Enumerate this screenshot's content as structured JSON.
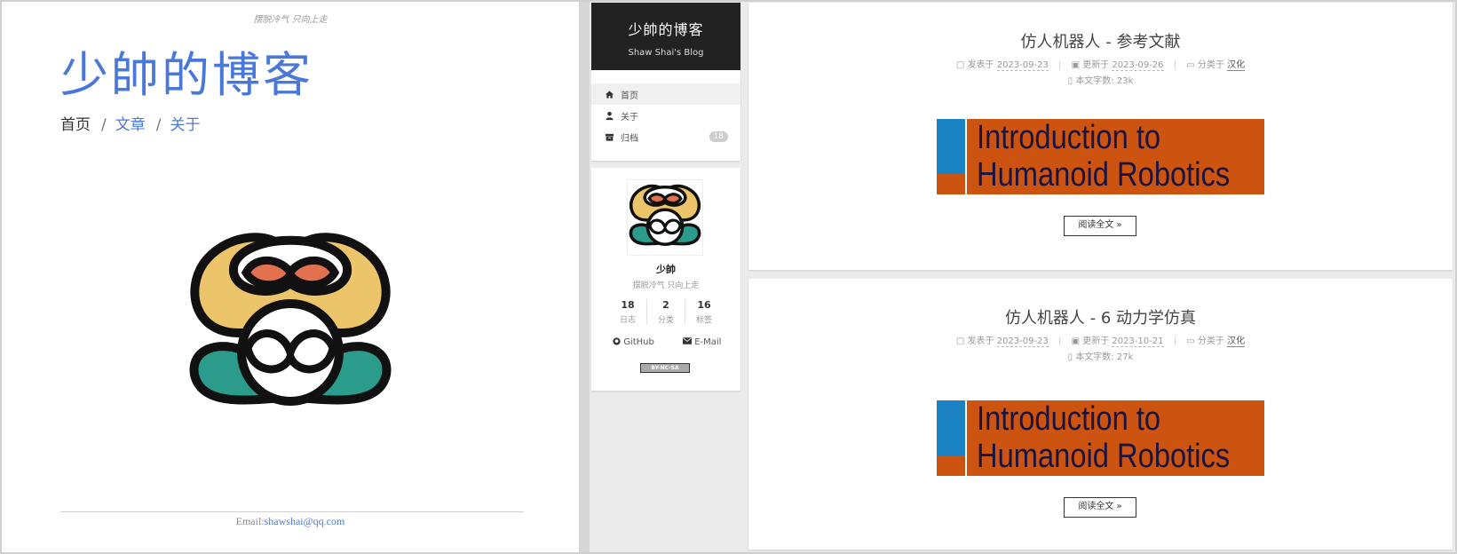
{
  "left_page": {
    "motto": "摆脱冷气 只向上走",
    "title": "少帥的博客",
    "nav": {
      "home": "首页",
      "sep1": "/",
      "articles": "文章",
      "sep2": "/",
      "about": "关于"
    },
    "footer": {
      "prefix": "Email:",
      "email": "shawshai@qq.com"
    }
  },
  "sidebar": {
    "site_title": "少帥的博客",
    "site_subtitle": "Shaw Shai's Blog",
    "menu": [
      {
        "label": "首页",
        "icon": "home-icon"
      },
      {
        "label": "关于",
        "icon": "user-icon"
      },
      {
        "label": "归档",
        "icon": "archive-icon",
        "badge": "18"
      }
    ],
    "author": {
      "name": "少帥",
      "description": "摆脱冷气 只向上走",
      "stats": [
        {
          "count": "18",
          "label": "日志"
        },
        {
          "count": "2",
          "label": "分类"
        },
        {
          "count": "16",
          "label": "标签"
        }
      ],
      "links": {
        "github": "GitHub",
        "email": "E-Mail"
      },
      "license": "BY-NC-SA"
    }
  },
  "posts": [
    {
      "title": "仿人机器人 - 参考文献",
      "posted_label": "发表于",
      "posted": "2023-09-23",
      "updated_label": "更新于",
      "updated": "2023-09-26",
      "category_label": "分类于",
      "category": "汉化",
      "wordcount_label": "本文字数:",
      "wordcount": "23k",
      "banner_line1": "Introduction to",
      "banner_line2": "Humanoid Robotics",
      "read_more": "阅读全文 »"
    },
    {
      "title": "仿人机器人 - 6 动力学仿真",
      "posted_label": "发表于",
      "posted": "2023-09-23",
      "updated_label": "更新于",
      "updated": "2023-10-21",
      "category_label": "分类于",
      "category": "汉化",
      "wordcount_label": "本文字数:",
      "wordcount": "27k",
      "banner_line1": "Introduction to",
      "banner_line2": "Humanoid Robotics",
      "read_more": "阅读全文 »"
    }
  ],
  "colors": {
    "link_blue": "#4a78d8",
    "banner_orange": "#cc5310",
    "banner_blue": "#1b82c4",
    "header_dark": "#222222"
  }
}
